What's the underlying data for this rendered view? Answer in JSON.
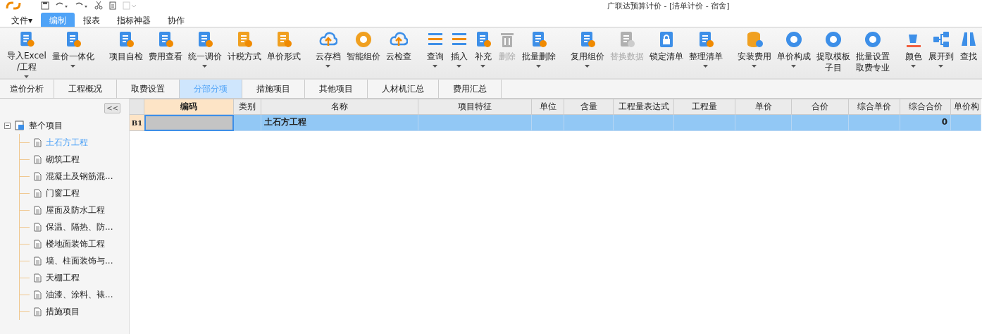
{
  "window": {
    "title": "广联达预算计价 - [清单计价 - 宿舍]"
  },
  "menu": [
    {
      "label": "文件▾",
      "selected": false
    },
    {
      "label": "编制",
      "selected": true
    },
    {
      "label": "报表",
      "selected": false
    },
    {
      "label": "指标神器",
      "selected": false
    },
    {
      "label": "协作",
      "selected": false
    }
  ],
  "ribbon": {
    "groups": [
      [
        {
          "lines": [
            "导入Excel",
            "/工程"
          ],
          "dropdown": true,
          "disabled": false
        },
        {
          "lines": [
            "量价一体化"
          ],
          "dropdown": true,
          "disabled": false
        }
      ],
      [
        {
          "lines": [
            "项目自检"
          ],
          "dropdown": false,
          "disabled": false
        },
        {
          "lines": [
            "费用查看"
          ],
          "dropdown": false,
          "disabled": false
        },
        {
          "lines": [
            "统一调价"
          ],
          "dropdown": true,
          "disabled": false
        },
        {
          "lines": [
            "计税方式"
          ],
          "dropdown": false,
          "disabled": false
        },
        {
          "lines": [
            "单价形式"
          ],
          "dropdown": false,
          "disabled": false
        }
      ],
      [
        {
          "lines": [
            "云存档"
          ],
          "dropdown": true,
          "disabled": false
        },
        {
          "lines": [
            "智能组价"
          ],
          "dropdown": false,
          "disabled": false
        },
        {
          "lines": [
            "云检查"
          ],
          "dropdown": false,
          "disabled": false
        }
      ],
      [
        {
          "lines": [
            "查询"
          ],
          "dropdown": true,
          "disabled": false
        },
        {
          "lines": [
            "插入"
          ],
          "dropdown": true,
          "disabled": false
        },
        {
          "lines": [
            "补充"
          ],
          "dropdown": true,
          "disabled": false
        },
        {
          "lines": [
            "删除"
          ],
          "dropdown": false,
          "disabled": true
        },
        {
          "lines": [
            "批量删除"
          ],
          "dropdown": true,
          "disabled": false
        }
      ],
      [
        {
          "lines": [
            "复用组价"
          ],
          "dropdown": true,
          "disabled": false
        },
        {
          "lines": [
            "替换数据"
          ],
          "dropdown": false,
          "disabled": true
        },
        {
          "lines": [
            "锁定清单"
          ],
          "dropdown": false,
          "disabled": false
        },
        {
          "lines": [
            "整理清单"
          ],
          "dropdown": true,
          "disabled": false
        }
      ],
      [
        {
          "lines": [
            "安装费用"
          ],
          "dropdown": true,
          "disabled": false
        },
        {
          "lines": [
            "单价构成"
          ],
          "dropdown": true,
          "disabled": false
        },
        {
          "lines": [
            "提取模板",
            "子目"
          ],
          "dropdown": false,
          "disabled": false
        },
        {
          "lines": [
            "批量设置",
            "取费专业"
          ],
          "dropdown": false,
          "disabled": false
        }
      ],
      [
        {
          "lines": [
            "颜色"
          ],
          "dropdown": true,
          "disabled": false
        },
        {
          "lines": [
            "展开到"
          ],
          "dropdown": true,
          "disabled": false
        },
        {
          "lines": [
            "查找"
          ],
          "dropdown": false,
          "disabled": false
        }
      ]
    ]
  },
  "tabs": [
    {
      "label": "造价分析",
      "selected": false
    },
    {
      "label": "工程概况",
      "selected": false
    },
    {
      "label": "取费设置",
      "selected": false
    },
    {
      "label": "分部分项",
      "selected": true
    },
    {
      "label": "措施项目",
      "selected": false
    },
    {
      "label": "其他项目",
      "selected": false
    },
    {
      "label": "人材机汇总",
      "selected": false
    },
    {
      "label": "费用汇总",
      "selected": false
    }
  ],
  "sidebar": {
    "collapse_button": "<<",
    "tree": {
      "label": "整个项目",
      "expanded": true,
      "children": [
        {
          "label": "土石方工程",
          "selected": true
        },
        {
          "label": "砌筑工程",
          "selected": false
        },
        {
          "label": "混凝土及钢筋混...",
          "selected": false
        },
        {
          "label": "门窗工程",
          "selected": false
        },
        {
          "label": "屋面及防水工程",
          "selected": false
        },
        {
          "label": "保温、隔热、防...",
          "selected": false
        },
        {
          "label": "楼地面装饰工程",
          "selected": false
        },
        {
          "label": "墙、柱面装饰与...",
          "selected": false
        },
        {
          "label": "天棚工程",
          "selected": false
        },
        {
          "label": "油漆、涂料、裱...",
          "selected": false
        },
        {
          "label": "措施项目",
          "selected": false
        }
      ]
    }
  },
  "table": {
    "columns": [
      {
        "label": "编码",
        "selected": true
      },
      {
        "label": "类别",
        "selected": false
      },
      {
        "label": "名称",
        "selected": false
      },
      {
        "label": "项目特征",
        "selected": false
      },
      {
        "label": "单位",
        "selected": false
      },
      {
        "label": "含量",
        "selected": false
      },
      {
        "label": "工程量表达式",
        "selected": false
      },
      {
        "label": "工程量",
        "selected": false
      },
      {
        "label": "单价",
        "selected": false
      },
      {
        "label": "合价",
        "selected": false
      },
      {
        "label": "综合单价",
        "selected": false
      },
      {
        "label": "综合合价",
        "selected": false
      },
      {
        "label": "单价构",
        "selected": false
      }
    ],
    "rows": [
      {
        "row_label": "B1",
        "selected": true,
        "cells": [
          "",
          "",
          "土石方工程",
          "",
          "",
          "",
          "",
          "",
          "",
          "",
          "",
          "0",
          ""
        ]
      }
    ]
  }
}
